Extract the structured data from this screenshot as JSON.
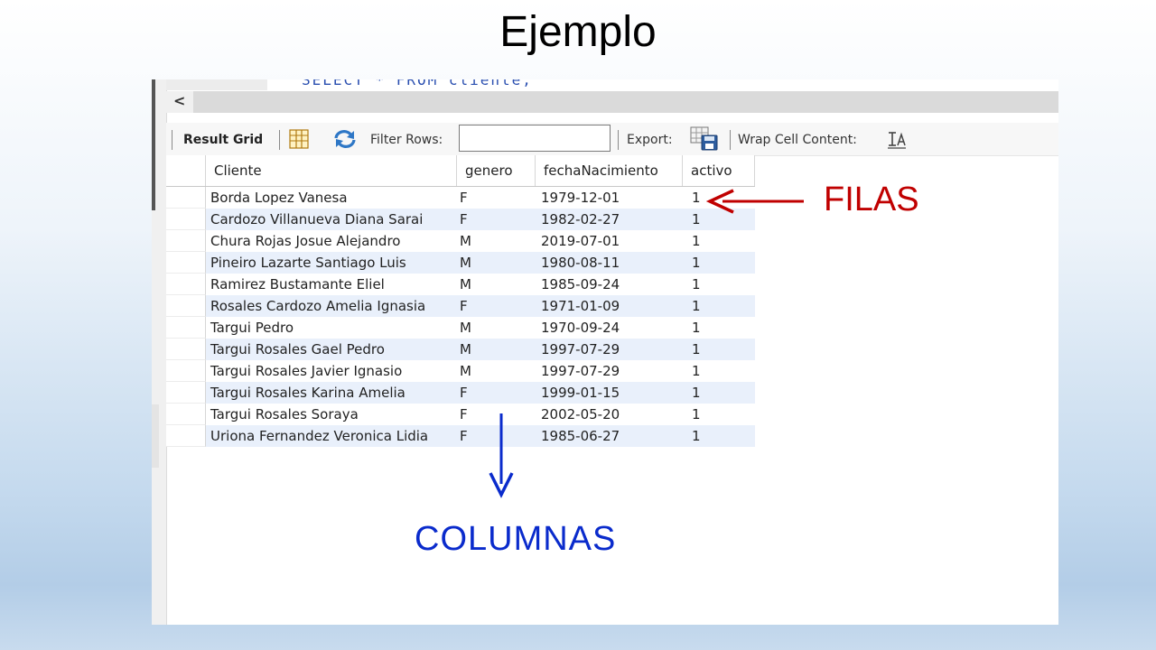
{
  "slide": {
    "title": "Ejemplo"
  },
  "toolbar": {
    "result_grid": "Result Grid",
    "filter_rows": "Filter Rows:",
    "filter_value": "",
    "export": "Export:",
    "wrap_cell_content": "Wrap Cell Content:"
  },
  "editor": {
    "partial_code": "SELECT * FROM cliente;"
  },
  "scroll": {
    "left_arrow": "<"
  },
  "table": {
    "columns": [
      "Cliente",
      "genero",
      "fechaNacimiento",
      "activo"
    ],
    "rows": [
      [
        "Borda Lopez Vanesa",
        "F",
        "1979-12-01",
        "1"
      ],
      [
        "Cardozo Villanueva Diana Sarai",
        "F",
        "1982-02-27",
        "1"
      ],
      [
        "Chura Rojas Josue Alejandro",
        "M",
        "2019-07-01",
        "1"
      ],
      [
        "Pineiro Lazarte Santiago Luis",
        "M",
        "1980-08-11",
        "1"
      ],
      [
        "Ramirez Bustamante Eliel",
        "M",
        "1985-09-24",
        "1"
      ],
      [
        "Rosales Cardozo Amelia Ignasia",
        "F",
        "1971-01-09",
        "1"
      ],
      [
        "Targui  Pedro",
        "M",
        "1970-09-24",
        "1"
      ],
      [
        "Targui Rosales Gael Pedro",
        "M",
        "1997-07-29",
        "1"
      ],
      [
        "Targui Rosales Javier Ignasio",
        "M",
        "1997-07-29",
        "1"
      ],
      [
        "Targui Rosales Karina Amelia",
        "F",
        "1999-01-15",
        "1"
      ],
      [
        "Targui Rosales Soraya",
        "F",
        "2002-05-20",
        "1"
      ],
      [
        "Uriona Fernandez Veronica Lidia",
        "F",
        "1985-06-27",
        "1"
      ]
    ]
  },
  "annotations": {
    "rows_label": "FILAS",
    "columns_label": "COLUMNAS"
  },
  "colors": {
    "rows_accent": "#c00000",
    "columns_accent": "#0a2bcc",
    "alt_row": "#e9f0fb"
  },
  "icons": [
    "grid-columns-icon",
    "refresh-icon",
    "export-icon",
    "wrap-text-icon"
  ]
}
